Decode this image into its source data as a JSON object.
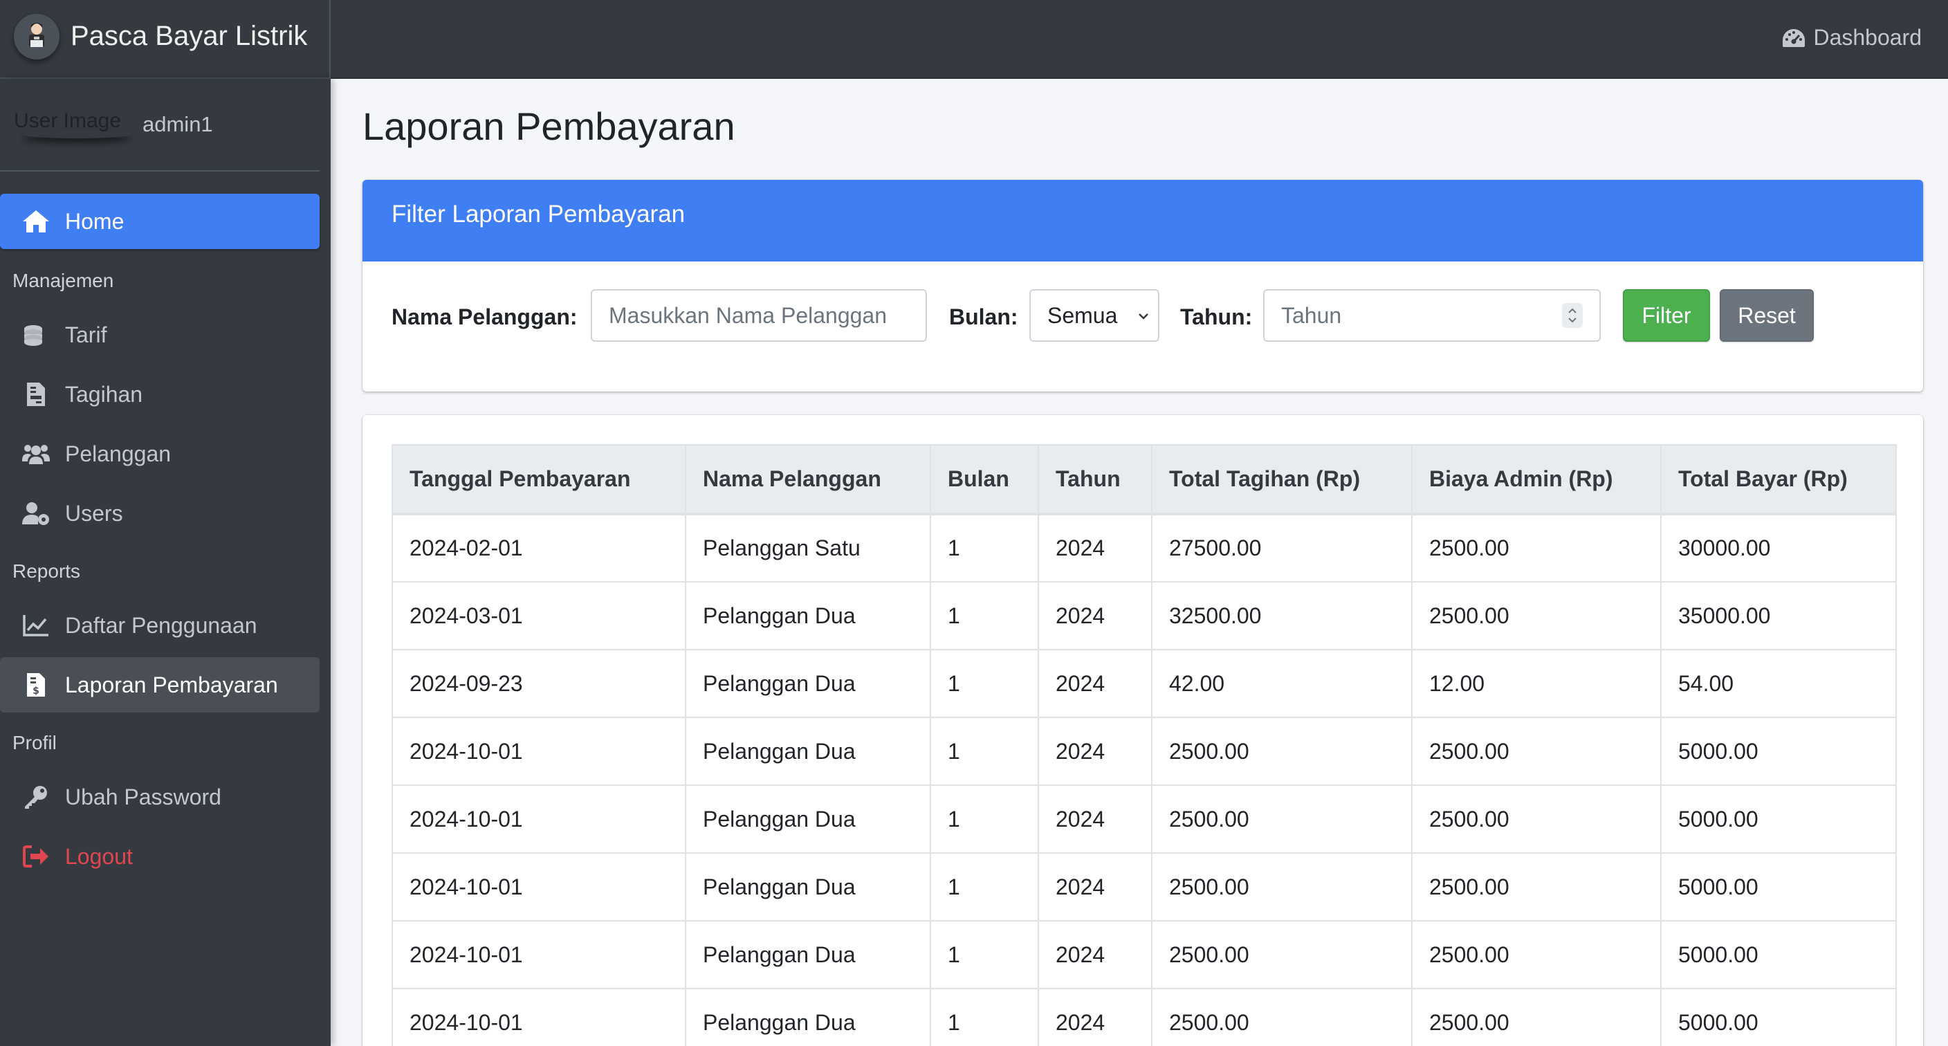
{
  "app": {
    "brand": "Pasca Bayar Listrik",
    "nav_right_label": "Dashboard"
  },
  "sidebar": {
    "user_image_alt": "User Image",
    "user_name": "admin1",
    "items": [
      {
        "label": "Home",
        "icon": "home-icon"
      },
      {
        "label": "Tarif",
        "icon": "coins-icon"
      },
      {
        "label": "Tagihan",
        "icon": "file-invoice-icon"
      },
      {
        "label": "Pelanggan",
        "icon": "users-icon"
      },
      {
        "label": "Users",
        "icon": "user-cog-icon"
      },
      {
        "label": "Daftar Penggunaan",
        "icon": "chart-line-icon"
      },
      {
        "label": "Laporan Pembayaran",
        "icon": "file-invoice-dollar-icon"
      },
      {
        "label": "Ubah Password",
        "icon": "key-icon"
      },
      {
        "label": "Logout",
        "icon": "sign-out-icon"
      }
    ],
    "headers": [
      "Manajemen",
      "Reports",
      "Profil"
    ]
  },
  "page": {
    "title": "Laporan Pembayaran"
  },
  "filter": {
    "title": "Filter Laporan Pembayaran",
    "nama_label": "Nama Pelanggan:",
    "nama_placeholder": "Masukkan Nama Pelanggan",
    "bulan_label": "Bulan:",
    "bulan_selected": "Semua",
    "tahun_label": "Tahun:",
    "tahun_placeholder": "Tahun",
    "filter_button": "Filter",
    "reset_button": "Reset"
  },
  "table": {
    "columns": [
      "Tanggal Pembayaran",
      "Nama Pelanggan",
      "Bulan",
      "Tahun",
      "Total Tagihan (Rp)",
      "Biaya Admin (Rp)",
      "Total Bayar (Rp)"
    ],
    "rows": [
      [
        "2024-02-01",
        "Pelanggan Satu",
        "1",
        "2024",
        "27500.00",
        "2500.00",
        "30000.00"
      ],
      [
        "2024-03-01",
        "Pelanggan Dua",
        "1",
        "2024",
        "32500.00",
        "2500.00",
        "35000.00"
      ],
      [
        "2024-09-23",
        "Pelanggan Dua",
        "1",
        "2024",
        "42.00",
        "12.00",
        "54.00"
      ],
      [
        "2024-10-01",
        "Pelanggan Dua",
        "1",
        "2024",
        "2500.00",
        "2500.00",
        "5000.00"
      ],
      [
        "2024-10-01",
        "Pelanggan Dua",
        "1",
        "2024",
        "2500.00",
        "2500.00",
        "5000.00"
      ],
      [
        "2024-10-01",
        "Pelanggan Dua",
        "1",
        "2024",
        "2500.00",
        "2500.00",
        "5000.00"
      ],
      [
        "2024-10-01",
        "Pelanggan Dua",
        "1",
        "2024",
        "2500.00",
        "2500.00",
        "5000.00"
      ],
      [
        "2024-10-01",
        "Pelanggan Dua",
        "1",
        "2024",
        "2500.00",
        "2500.00",
        "5000.00"
      ]
    ]
  }
}
